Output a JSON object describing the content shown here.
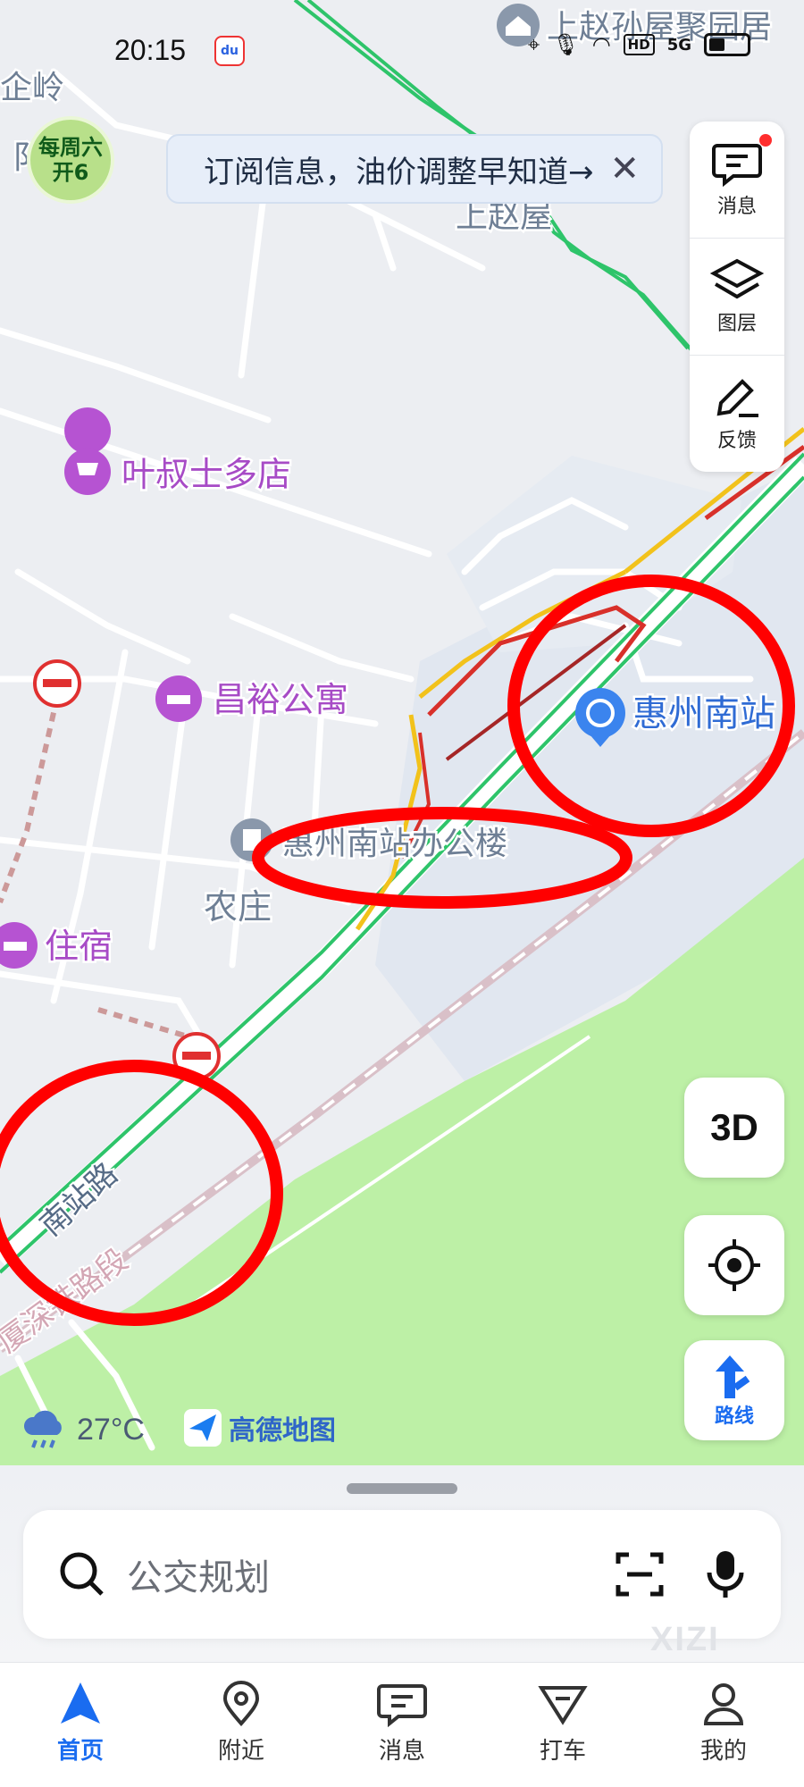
{
  "status_bar": {
    "time": "20:15",
    "app_icon": "baidu-app-icon",
    "network": "5G",
    "hd": "HD"
  },
  "badge": {
    "line1": "每周六",
    "line2": "开6"
  },
  "promo": {
    "text": "订阅信息，油价调整早知道→",
    "close": "✕"
  },
  "side_tools": [
    {
      "label": "消息",
      "icon": "message-icon",
      "has_dot": true
    },
    {
      "label": "图层",
      "icon": "layers-icon"
    },
    {
      "label": "反馈",
      "icon": "feedback-pen-icon"
    }
  ],
  "map": {
    "pois": {
      "top_right": "上赵孙屋聚园居",
      "shang_zhao_wu": "上赵屋",
      "top_left": "企岭",
      "top_left_2": "阝",
      "store": "叶叔士多店",
      "apartment": "昌裕公寓",
      "station": "惠州南站",
      "office": "惠州南站办公楼",
      "village": "农庄",
      "lodging": "住宿"
    },
    "roads": {
      "south_station_road": "南站路",
      "railway": "厦深铁路段"
    },
    "colors": {
      "green_area": "#bdf0a6",
      "traffic_green": "#2ec46a",
      "traffic_yellow": "#f2c21b",
      "traffic_red": "#d8302a",
      "annotation_red": "#ff0000"
    }
  },
  "fabs": {
    "three_d": "3D",
    "route_label": "路线"
  },
  "weather": {
    "temp": "27°C",
    "icon": "rain-cloud-icon"
  },
  "brand": {
    "name": "高德地图"
  },
  "search": {
    "placeholder": "公交规划"
  },
  "watermark": "XIZI",
  "nav": [
    {
      "label": "首页",
      "icon": "navigation-arrow-icon",
      "active": true
    },
    {
      "label": "附近",
      "icon": "location-pin-icon"
    },
    {
      "label": "消息",
      "icon": "message-icon"
    },
    {
      "label": "打车",
      "icon": "taxi-icon"
    },
    {
      "label": "我的",
      "icon": "user-icon"
    }
  ]
}
